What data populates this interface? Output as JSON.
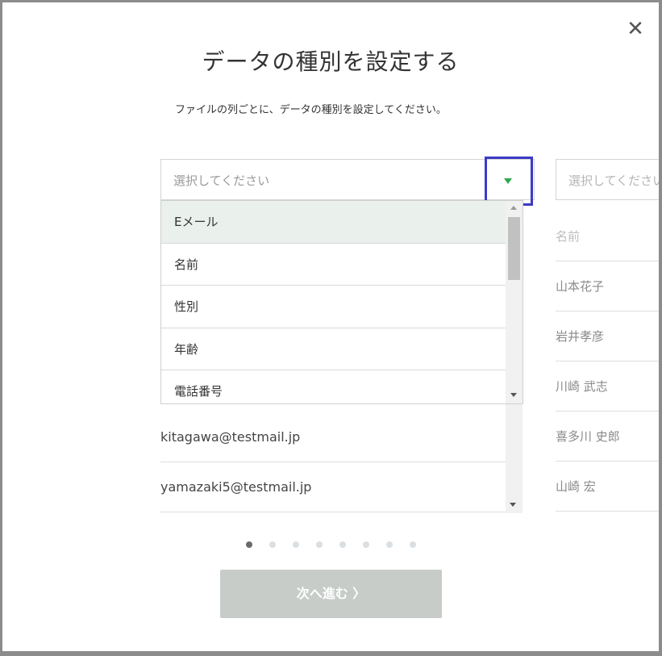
{
  "dialog": {
    "close_glyph": "✕",
    "title": "データの種別を設定する",
    "subtitle": "ファイルの列ごとに、データの種別を設定してください。"
  },
  "column1": {
    "select_placeholder": "選択してください",
    "rows": [
      "kitagawa@testmail.jp",
      "yamazaki5@testmail.jp"
    ]
  },
  "column2": {
    "select_placeholder": "選択してください",
    "rows": [
      "名前",
      "山本花子",
      "岩井孝彦",
      "川崎 武志",
      "喜多川 史郎",
      "山崎 宏"
    ]
  },
  "dropdown": {
    "options": [
      "Eメール",
      "名前",
      "性別",
      "年齢",
      "電話番号"
    ],
    "highlighted_index": 0
  },
  "pagination": {
    "total": 8,
    "active_index": 0
  },
  "next_button": {
    "label": "次へ進む 〉"
  },
  "colors": {
    "accent_arrow": "#2fa84f",
    "focus_outline": "#3b3bc7",
    "highlight": "#eaf0ec",
    "button_disabled": "#c7ccc9"
  }
}
